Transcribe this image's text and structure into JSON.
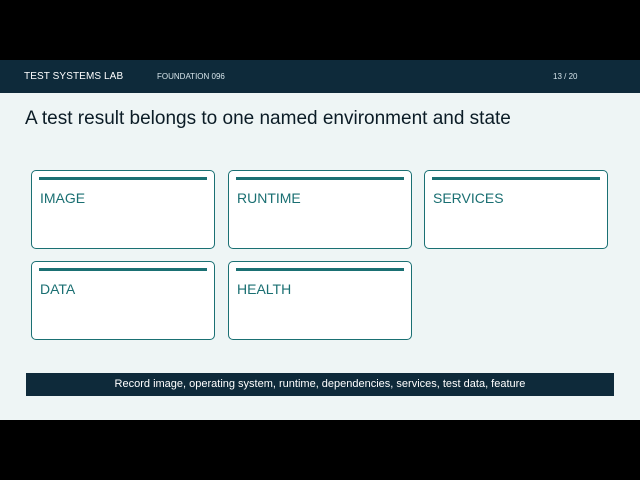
{
  "header": {
    "brand": "TEST SYSTEMS LAB",
    "section": "FOUNDATION 096",
    "pager": "13 / 20"
  },
  "slide": {
    "title": "A test result belongs to one named environment and state",
    "cards": [
      {
        "label": "IMAGE"
      },
      {
        "label": "RUNTIME"
      },
      {
        "label": "SERVICES"
      },
      {
        "label": "DATA"
      },
      {
        "label": "HEALTH"
      }
    ],
    "footer": "Record image, operating system, runtime, dependencies, services, test data, feature"
  },
  "colors": {
    "header_bg": "#0e2a3a",
    "slide_bg": "#eef5f5",
    "accent": "#1a7073",
    "frame": "#000000"
  }
}
